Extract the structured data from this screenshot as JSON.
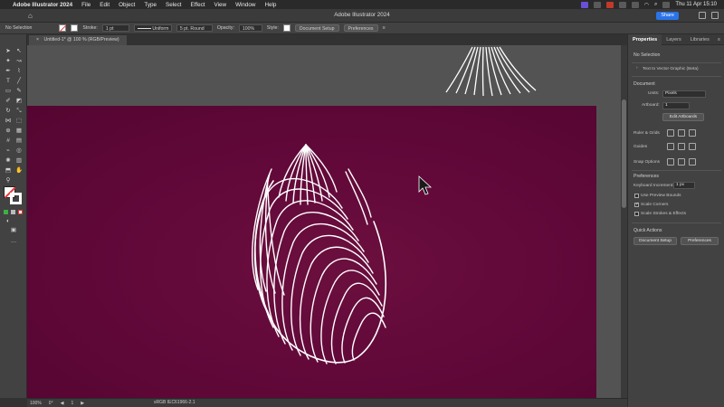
{
  "menubar": {
    "app": "Adobe Illustrator 2024",
    "items": [
      "File",
      "Edit",
      "Object",
      "Type",
      "Select",
      "Effect",
      "View",
      "Window",
      "Help"
    ],
    "datetime": "Thu 11 Apr  15:10"
  },
  "titlebar": {
    "title": "Adobe Illustrator 2024",
    "share": "Share"
  },
  "controlbar": {
    "selection": "No Selection",
    "stroke_label": "Stroke:",
    "stroke_weight": "1 pt",
    "profile": "Uniform",
    "brush": "5 pt. Round",
    "opacity_label": "Opacity:",
    "opacity": "100%",
    "style_label": "Style:",
    "document_setup": "Document Setup",
    "preferences": "Preferences"
  },
  "document": {
    "tab": "Untitled-1* @ 100 % (RGB/Preview)",
    "close": "×"
  },
  "statusbar": {
    "zoom": "100%",
    "rotate": "0°",
    "artboard_num": "1",
    "color_mode": "sRGB IEC61966-2.1"
  },
  "right_panel": {
    "tabs": [
      "Properties",
      "Layers",
      "Libraries"
    ],
    "no_selection": "No Selection",
    "text_to_vector": "Text to Vector Graphic (Beta)",
    "document_header": "Document",
    "units_label": "Units:",
    "units_value": "Pixels",
    "artboard_label": "Artboard:",
    "artboard_value": "1",
    "edit_artboards": "Edit Artboards",
    "rulers_grids": "Ruler & Grids",
    "guides": "Guides",
    "snap_options": "Snap Options",
    "preferences_header": "Preferences",
    "keyboard_increment_label": "Keyboard Increment:",
    "keyboard_increment_value": "1 px",
    "use_preview_bounds": "Use Preview Bounds",
    "use_preview_bounds_checked": false,
    "scale_corners": "Scale Corners",
    "scale_corners_checked": true,
    "scale_strokes": "Scale Strokes & Effects",
    "scale_strokes_checked": false,
    "quick_actions": "Quick Actions",
    "qa_document_setup": "Document Setup",
    "qa_preferences": "Preferences"
  },
  "colors": {
    "artboard": "#62093a",
    "pasteboard": "#535353",
    "accent": "#2b73e8"
  },
  "icons": [
    "apple-logo",
    "home-icon",
    "pen-tool-icon",
    "selection-tool-icon",
    "cursor-arrow-icon"
  ]
}
